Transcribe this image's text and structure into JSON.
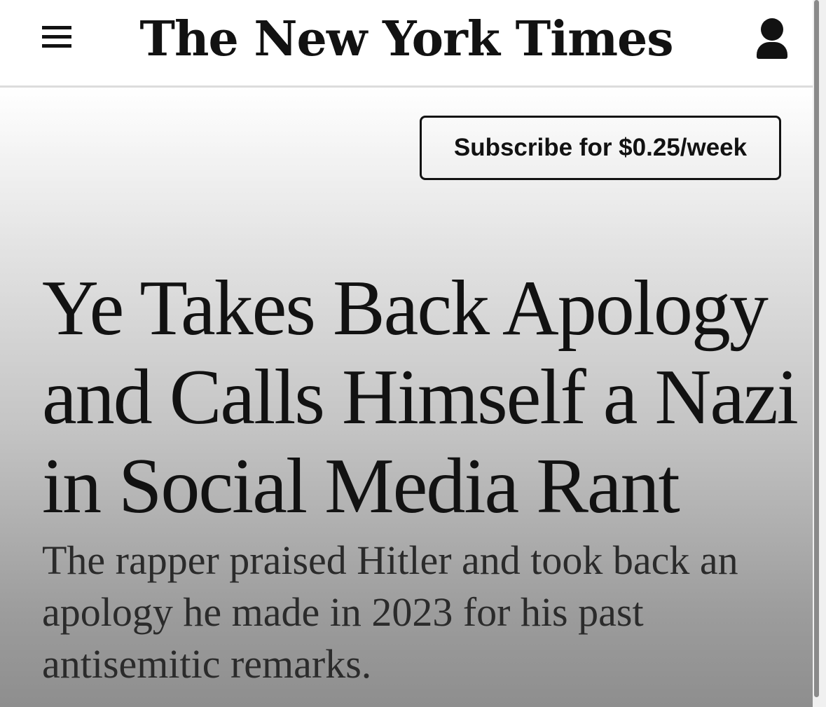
{
  "header": {
    "masthead": "The New York Times",
    "menu_icon": "hamburger-menu-icon",
    "account_icon": "person-icon"
  },
  "subscribe": {
    "label": "Subscribe for $0.25/week"
  },
  "article": {
    "headline": "Ye Takes Back Apology and Calls Himself a Nazi in Social Media Rant",
    "summary": "The rapper praised Hitler and took back an apology he made in 2023 for his past antisemitic remarks."
  },
  "colors": {
    "text": "#121212",
    "summary_text": "#2b2b2b",
    "header_bg": "#ffffff",
    "header_border": "#dcdcdc"
  }
}
